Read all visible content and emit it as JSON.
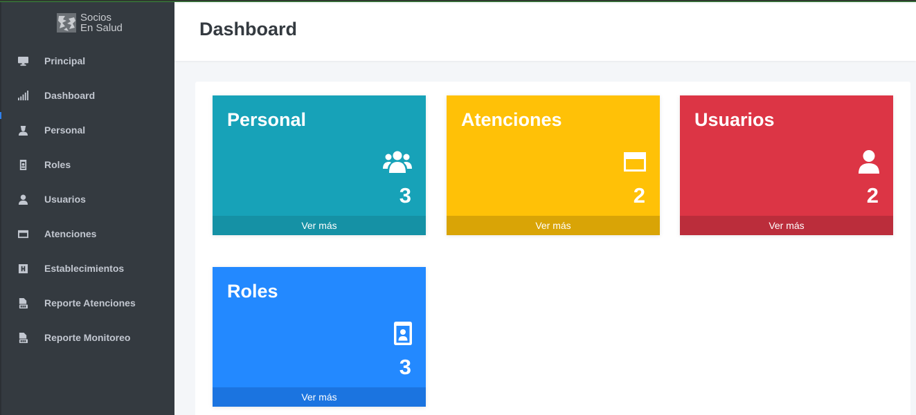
{
  "brand": {
    "line1": "Socios",
    "line2": "En Salud"
  },
  "header": {
    "title": "Dashboard"
  },
  "sidebar": {
    "items": [
      {
        "label": "Principal",
        "icon": "desktop-icon"
      },
      {
        "label": "Dashboard",
        "icon": "signal-icon"
      },
      {
        "label": "Personal",
        "icon": "user-nurse-icon"
      },
      {
        "label": "Roles",
        "icon": "id-badge-icon"
      },
      {
        "label": "Usuarios",
        "icon": "user-icon"
      },
      {
        "label": "Atenciones",
        "icon": "window-icon"
      },
      {
        "label": "Establecimientos",
        "icon": "hospital-icon"
      },
      {
        "label": "Reporte Atenciones",
        "icon": "file-pdf-icon"
      },
      {
        "label": "Reporte Monitoreo",
        "icon": "file-pdf-icon"
      }
    ]
  },
  "tiles": [
    {
      "title": "Personal",
      "count": "3",
      "link": "Ver más",
      "icon": "users-icon",
      "color": "#17a2b8",
      "footer_color": "#1591a5"
    },
    {
      "title": "Atenciones",
      "count": "2",
      "link": "Ver más",
      "icon": "window-icon",
      "color": "#ffc107",
      "footer_color": "#d9a406"
    },
    {
      "title": "Usuarios",
      "count": "2",
      "link": "Ver más",
      "icon": "user-icon",
      "color": "#dc3545",
      "footer_color": "#bb2d3b"
    },
    {
      "title": "Roles",
      "count": "3",
      "link": "Ver más",
      "icon": "id-badge-icon",
      "color": "#2389ff",
      "footer_color": "#1b74e0"
    }
  ]
}
